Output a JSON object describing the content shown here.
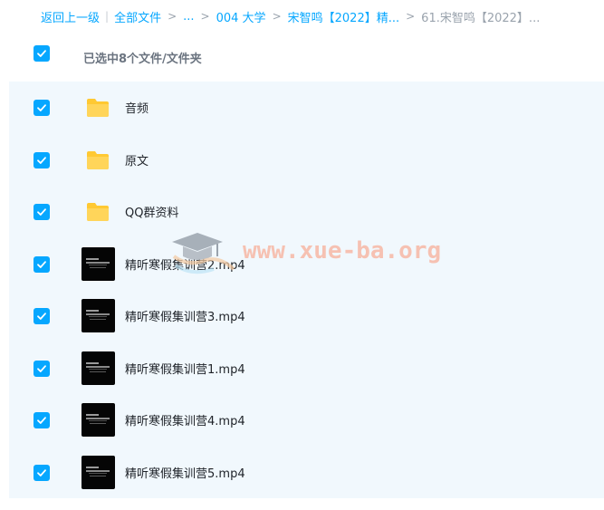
{
  "breadcrumb": {
    "back": "返回上一级",
    "all_files": "全部文件",
    "ellipsis": "...",
    "folder1": "004 大学",
    "folder2": "宋智鸣【2022】精...",
    "current": "61.宋智鸣【2022】..."
  },
  "header": {
    "selected_count": "已选中8个文件/文件夹"
  },
  "files": [
    {
      "name": "音频",
      "type": "folder"
    },
    {
      "name": "原文",
      "type": "folder"
    },
    {
      "name": "QQ群资料",
      "type": "folder"
    },
    {
      "name": "精听寒假集训营2.mp4",
      "type": "video"
    },
    {
      "name": "精听寒假集训营3.mp4",
      "type": "video"
    },
    {
      "name": "精听寒假集训营1.mp4",
      "type": "video"
    },
    {
      "name": "精听寒假集训营4.mp4",
      "type": "video"
    },
    {
      "name": "精听寒假集训营5.mp4",
      "type": "video"
    }
  ],
  "watermark": {
    "text": "www.xue-ba.org"
  },
  "colors": {
    "accent": "#06a7ff",
    "folder": "#ffc933",
    "row_selected_bg": "#f1f8fd"
  }
}
